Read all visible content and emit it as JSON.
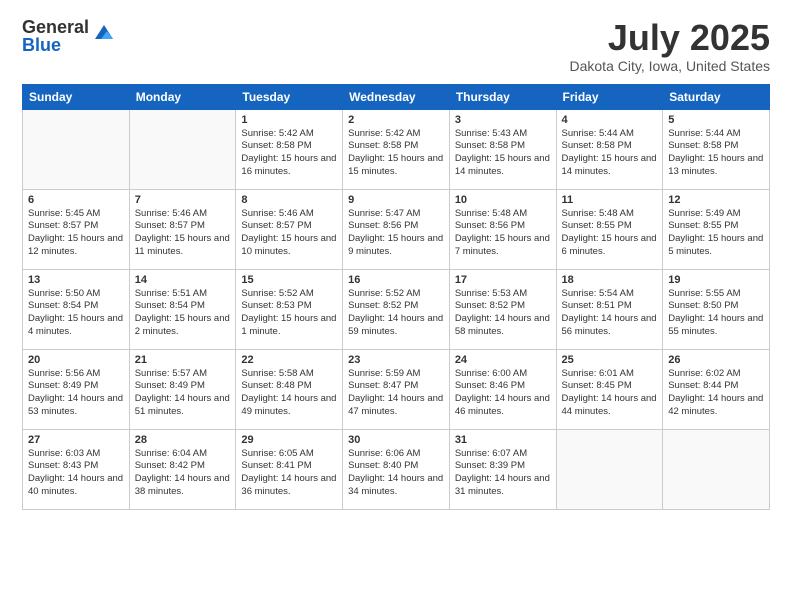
{
  "logo": {
    "general": "General",
    "blue": "Blue"
  },
  "title": "July 2025",
  "location": "Dakota City, Iowa, United States",
  "headers": [
    "Sunday",
    "Monday",
    "Tuesday",
    "Wednesday",
    "Thursday",
    "Friday",
    "Saturday"
  ],
  "weeks": [
    [
      {
        "num": "",
        "info": ""
      },
      {
        "num": "",
        "info": ""
      },
      {
        "num": "1",
        "info": "Sunrise: 5:42 AM\nSunset: 8:58 PM\nDaylight: 15 hours and 16 minutes."
      },
      {
        "num": "2",
        "info": "Sunrise: 5:42 AM\nSunset: 8:58 PM\nDaylight: 15 hours and 15 minutes."
      },
      {
        "num": "3",
        "info": "Sunrise: 5:43 AM\nSunset: 8:58 PM\nDaylight: 15 hours and 14 minutes."
      },
      {
        "num": "4",
        "info": "Sunrise: 5:44 AM\nSunset: 8:58 PM\nDaylight: 15 hours and 14 minutes."
      },
      {
        "num": "5",
        "info": "Sunrise: 5:44 AM\nSunset: 8:58 PM\nDaylight: 15 hours and 13 minutes."
      }
    ],
    [
      {
        "num": "6",
        "info": "Sunrise: 5:45 AM\nSunset: 8:57 PM\nDaylight: 15 hours and 12 minutes."
      },
      {
        "num": "7",
        "info": "Sunrise: 5:46 AM\nSunset: 8:57 PM\nDaylight: 15 hours and 11 minutes."
      },
      {
        "num": "8",
        "info": "Sunrise: 5:46 AM\nSunset: 8:57 PM\nDaylight: 15 hours and 10 minutes."
      },
      {
        "num": "9",
        "info": "Sunrise: 5:47 AM\nSunset: 8:56 PM\nDaylight: 15 hours and 9 minutes."
      },
      {
        "num": "10",
        "info": "Sunrise: 5:48 AM\nSunset: 8:56 PM\nDaylight: 15 hours and 7 minutes."
      },
      {
        "num": "11",
        "info": "Sunrise: 5:48 AM\nSunset: 8:55 PM\nDaylight: 15 hours and 6 minutes."
      },
      {
        "num": "12",
        "info": "Sunrise: 5:49 AM\nSunset: 8:55 PM\nDaylight: 15 hours and 5 minutes."
      }
    ],
    [
      {
        "num": "13",
        "info": "Sunrise: 5:50 AM\nSunset: 8:54 PM\nDaylight: 15 hours and 4 minutes."
      },
      {
        "num": "14",
        "info": "Sunrise: 5:51 AM\nSunset: 8:54 PM\nDaylight: 15 hours and 2 minutes."
      },
      {
        "num": "15",
        "info": "Sunrise: 5:52 AM\nSunset: 8:53 PM\nDaylight: 15 hours and 1 minute."
      },
      {
        "num": "16",
        "info": "Sunrise: 5:52 AM\nSunset: 8:52 PM\nDaylight: 14 hours and 59 minutes."
      },
      {
        "num": "17",
        "info": "Sunrise: 5:53 AM\nSunset: 8:52 PM\nDaylight: 14 hours and 58 minutes."
      },
      {
        "num": "18",
        "info": "Sunrise: 5:54 AM\nSunset: 8:51 PM\nDaylight: 14 hours and 56 minutes."
      },
      {
        "num": "19",
        "info": "Sunrise: 5:55 AM\nSunset: 8:50 PM\nDaylight: 14 hours and 55 minutes."
      }
    ],
    [
      {
        "num": "20",
        "info": "Sunrise: 5:56 AM\nSunset: 8:49 PM\nDaylight: 14 hours and 53 minutes."
      },
      {
        "num": "21",
        "info": "Sunrise: 5:57 AM\nSunset: 8:49 PM\nDaylight: 14 hours and 51 minutes."
      },
      {
        "num": "22",
        "info": "Sunrise: 5:58 AM\nSunset: 8:48 PM\nDaylight: 14 hours and 49 minutes."
      },
      {
        "num": "23",
        "info": "Sunrise: 5:59 AM\nSunset: 8:47 PM\nDaylight: 14 hours and 47 minutes."
      },
      {
        "num": "24",
        "info": "Sunrise: 6:00 AM\nSunset: 8:46 PM\nDaylight: 14 hours and 46 minutes."
      },
      {
        "num": "25",
        "info": "Sunrise: 6:01 AM\nSunset: 8:45 PM\nDaylight: 14 hours and 44 minutes."
      },
      {
        "num": "26",
        "info": "Sunrise: 6:02 AM\nSunset: 8:44 PM\nDaylight: 14 hours and 42 minutes."
      }
    ],
    [
      {
        "num": "27",
        "info": "Sunrise: 6:03 AM\nSunset: 8:43 PM\nDaylight: 14 hours and 40 minutes."
      },
      {
        "num": "28",
        "info": "Sunrise: 6:04 AM\nSunset: 8:42 PM\nDaylight: 14 hours and 38 minutes."
      },
      {
        "num": "29",
        "info": "Sunrise: 6:05 AM\nSunset: 8:41 PM\nDaylight: 14 hours and 36 minutes."
      },
      {
        "num": "30",
        "info": "Sunrise: 6:06 AM\nSunset: 8:40 PM\nDaylight: 14 hours and 34 minutes."
      },
      {
        "num": "31",
        "info": "Sunrise: 6:07 AM\nSunset: 8:39 PM\nDaylight: 14 hours and 31 minutes."
      },
      {
        "num": "",
        "info": ""
      },
      {
        "num": "",
        "info": ""
      }
    ]
  ]
}
